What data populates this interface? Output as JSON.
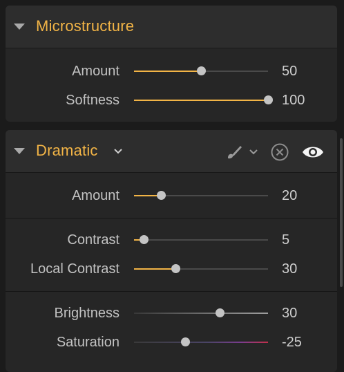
{
  "microstructure": {
    "title": "Microstructure",
    "sliders": [
      {
        "label": "Amount",
        "value": "50",
        "fraction": 0.5
      },
      {
        "label": "Softness",
        "value": "100",
        "fraction": 1.0
      }
    ]
  },
  "dramatic": {
    "title": "Dramatic",
    "chevron": "⌄",
    "tools": {
      "brush_icon": "brush-icon",
      "reset_icon": "reset-icon",
      "visibility_icon": "eye-icon"
    },
    "group_amount": [
      {
        "label": "Amount",
        "value": "20",
        "fraction": 0.2
      }
    ],
    "group_contrast": [
      {
        "label": "Contrast",
        "value": "5",
        "fraction": 0.07
      },
      {
        "label": "Local Contrast",
        "value": "30",
        "fraction": 0.31
      }
    ],
    "group_color": [
      {
        "label": "Brightness",
        "value": "30",
        "fraction": 0.64
      },
      {
        "label": "Saturation",
        "value": "-25",
        "fraction": 0.38
      }
    ]
  },
  "colors": {
    "accent": "#f2b446",
    "panel": "#262626",
    "header": "#2d2d2d",
    "knob": "#c4c4c4"
  }
}
